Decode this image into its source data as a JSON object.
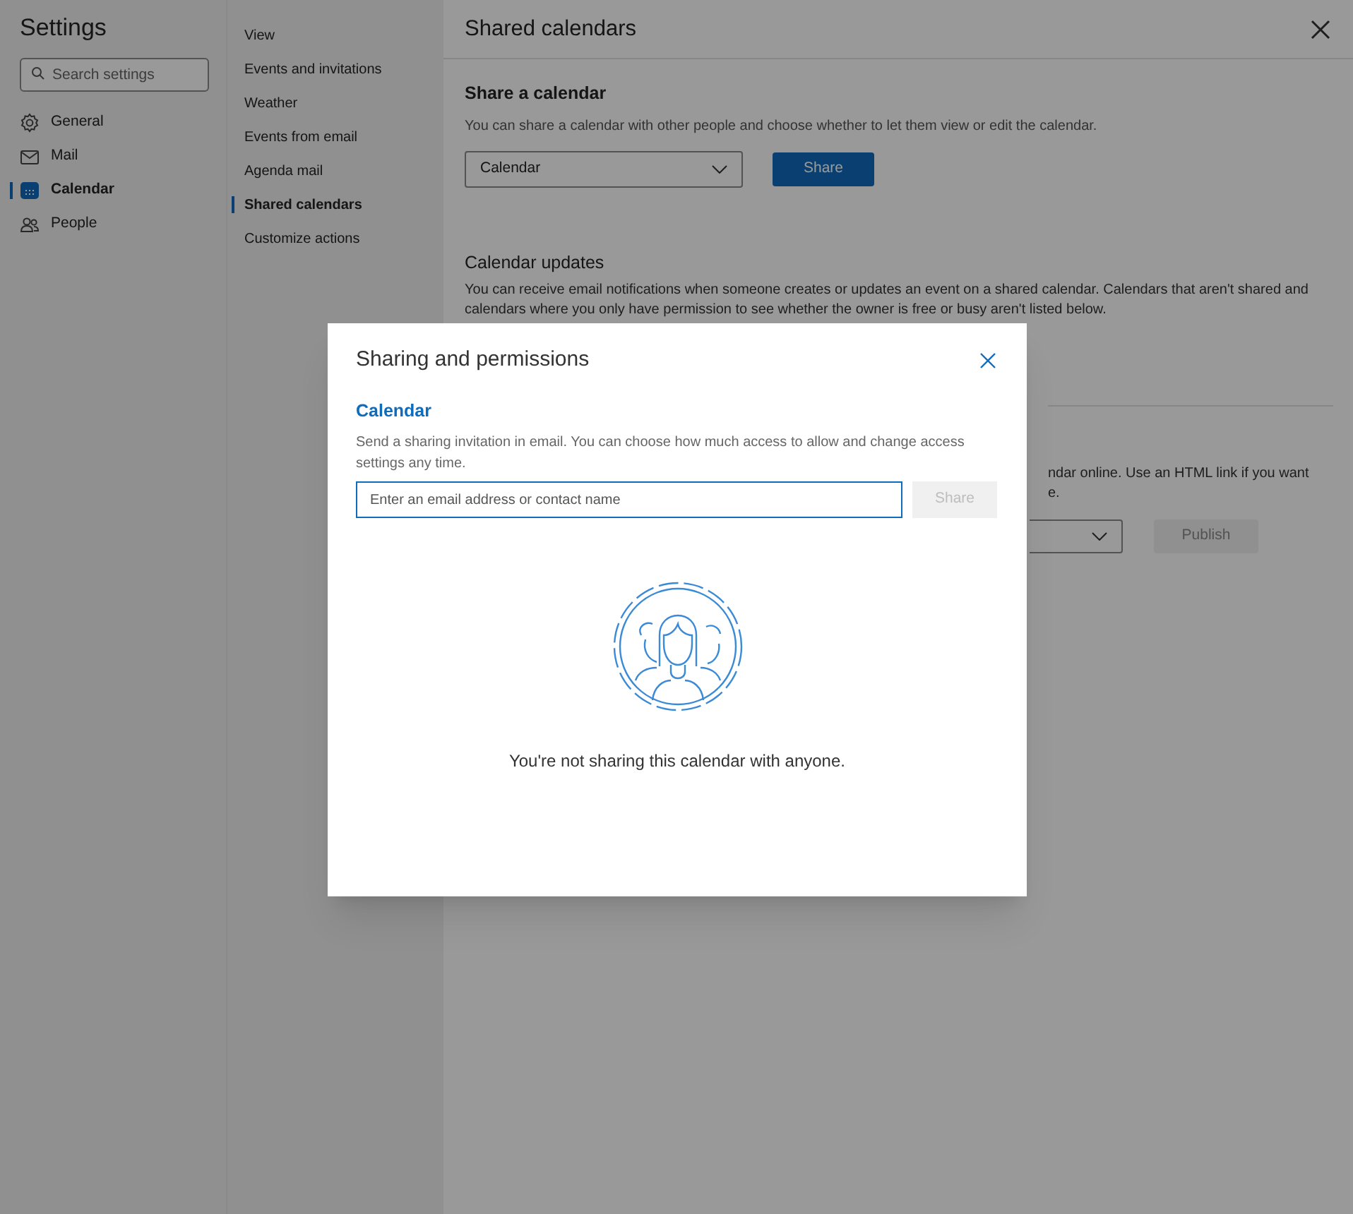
{
  "settings": {
    "title": "Settings",
    "search": {
      "placeholder": "Search settings"
    },
    "nav": [
      {
        "label": "General",
        "selected": false
      },
      {
        "label": "Mail",
        "selected": false
      },
      {
        "label": "Calendar",
        "selected": true
      },
      {
        "label": "People",
        "selected": false
      }
    ]
  },
  "submenu": [
    {
      "label": "View",
      "selected": false
    },
    {
      "label": "Events and invitations",
      "selected": false
    },
    {
      "label": "Weather",
      "selected": false
    },
    {
      "label": "Events from email",
      "selected": false
    },
    {
      "label": "Agenda mail",
      "selected": false
    },
    {
      "label": "Shared calendars",
      "selected": true
    },
    {
      "label": "Customize actions",
      "selected": false
    }
  ],
  "main": {
    "title": "Shared calendars",
    "share_section": {
      "heading": "Share a calendar",
      "description": "You can share a calendar with other people and choose whether to let them view or edit the calendar.",
      "calendar_dropdown": "Calendar",
      "button": "Share"
    },
    "updates_section": {
      "heading": "Calendar updates",
      "description": "You can receive email notifications when someone creates or updates an event on a shared calendar. Calendars that aren't shared and calendars where you only have permission to see whether the owner is free or busy aren't listed below."
    },
    "publish_section": {
      "description_lines": [
        "ndar online. Use an HTML link if you want",
        "e."
      ],
      "button": {
        "label": "Publish",
        "disabled": true
      }
    }
  },
  "dialog": {
    "title": "Sharing and permissions",
    "calendar_name": "Calendar",
    "description": "Send a sharing invitation in email. You can choose how much access to allow and change access settings any time.",
    "email_field": {
      "placeholder": "Enter an email address or contact name"
    },
    "share_button": {
      "label": "Share",
      "disabled": true
    },
    "empty_message": "You're not sharing this calendar with anyone."
  }
}
